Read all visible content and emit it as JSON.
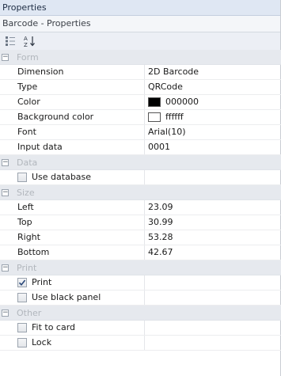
{
  "window": {
    "title": "Properties",
    "subtitle": "Barcode - Properties"
  },
  "toolbar": {
    "categorized_icon": "categorized-icon",
    "sort_icon": "sort-alphabetical-icon"
  },
  "categories": {
    "form": "Form",
    "data": "Data",
    "size": "Size",
    "print": "Print",
    "other": "Other"
  },
  "form": {
    "dimension": {
      "label": "Dimension",
      "value": "2D Barcode"
    },
    "type": {
      "label": "Type",
      "value": "QRCode"
    },
    "color": {
      "label": "Color",
      "value": "000000",
      "swatch": "#000000"
    },
    "background_color": {
      "label": "Background color",
      "value": "ffffff",
      "swatch": "#ffffff"
    },
    "font": {
      "label": "Font",
      "value": "Arial(10)"
    },
    "input_data": {
      "label": "Input data",
      "value": "0001"
    }
  },
  "data": {
    "use_database": {
      "label": "Use database",
      "checked": false
    }
  },
  "size": {
    "left": {
      "label": "Left",
      "value": "23.09"
    },
    "top": {
      "label": "Top",
      "value": "30.99"
    },
    "right": {
      "label": "Right",
      "value": "53.28"
    },
    "bottom": {
      "label": "Bottom",
      "value": "42.67"
    }
  },
  "print": {
    "print": {
      "label": "Print",
      "checked": true
    },
    "use_black_panel": {
      "label": "Use black panel",
      "checked": false
    }
  },
  "other": {
    "fit_to_card": {
      "label": "Fit to card",
      "checked": false
    },
    "lock": {
      "label": "Lock",
      "checked": false
    }
  }
}
